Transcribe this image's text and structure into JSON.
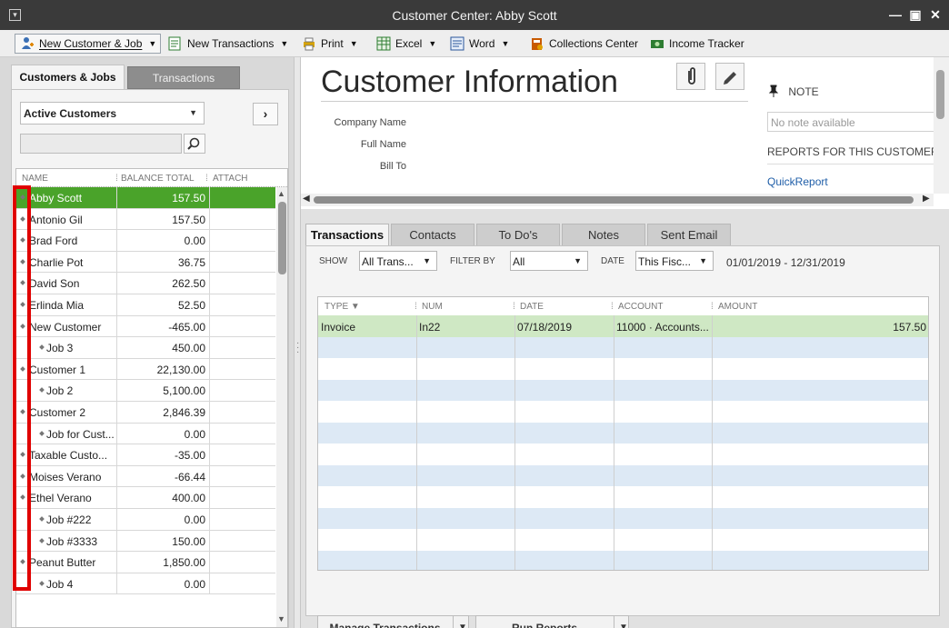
{
  "window": {
    "title": "Customer Center: Abby Scott"
  },
  "toolbar": {
    "new_customer_job": "New Customer & Job",
    "new_transactions": "New Transactions",
    "print": "Print",
    "excel": "Excel",
    "word": "Word",
    "collections_center": "Collections Center",
    "income_tracker": "Income Tracker"
  },
  "left": {
    "tab_customers_jobs": "Customers & Jobs",
    "tab_transactions": "Transactions",
    "filter_value": "Active Customers",
    "columns": {
      "name": "NAME",
      "balance": "BALANCE TOTAL",
      "attach": "ATTACH"
    },
    "rows": [
      {
        "name": "Abby Scott",
        "balance": "157.50",
        "job": false,
        "selected": true
      },
      {
        "name": "Antonio Gil",
        "balance": "157.50",
        "job": false
      },
      {
        "name": "Brad Ford",
        "balance": "0.00",
        "job": false
      },
      {
        "name": "Charlie Pot",
        "balance": "36.75",
        "job": false
      },
      {
        "name": "David Son",
        "balance": "262.50",
        "job": false
      },
      {
        "name": "Erlinda Mia",
        "balance": "52.50",
        "job": false
      },
      {
        "name": "New Customer",
        "balance": "-465.00",
        "job": false
      },
      {
        "name": "Job 3",
        "balance": "450.00",
        "job": true
      },
      {
        "name": "Customer 1",
        "balance": "22,130.00",
        "job": false
      },
      {
        "name": "Job 2",
        "balance": "5,100.00",
        "job": true
      },
      {
        "name": "Customer 2",
        "balance": "2,846.39",
        "job": false
      },
      {
        "name": "Job for Cust...",
        "balance": "0.00",
        "job": true
      },
      {
        "name": "Taxable Custo...",
        "balance": "-35.00",
        "job": false
      },
      {
        "name": "Moises Verano",
        "balance": "-66.44",
        "job": false
      },
      {
        "name": "Ethel Verano",
        "balance": "400.00",
        "job": false
      },
      {
        "name": "Job #222",
        "balance": "0.00",
        "job": true
      },
      {
        "name": "Job #3333",
        "balance": "150.00",
        "job": true
      },
      {
        "name": "Peanut Butter",
        "balance": "1,850.00",
        "job": false
      },
      {
        "name": "Job 4",
        "balance": "0.00",
        "job": true
      }
    ]
  },
  "info": {
    "title": "Customer Information",
    "company_name_label": "Company Name",
    "full_name_label": "Full Name",
    "bill_to_label": "Bill To",
    "note_label": "NOTE",
    "note_placeholder": "No note available",
    "reports_header": "REPORTS FOR THIS CUSTOMER",
    "quickreport": "QuickReport"
  },
  "tabs": [
    "Transactions",
    "Contacts",
    "To Do's",
    "Notes",
    "Sent Email"
  ],
  "filters": {
    "show_label": "SHOW",
    "show_value": "All Trans...",
    "filterby_label": "FILTER BY",
    "filterby_value": "All",
    "date_label": "DATE",
    "date_value": "This Fisc...",
    "date_range": "01/01/2019 - 12/31/2019"
  },
  "tx": {
    "columns": {
      "type": "TYPE",
      "num": "NUM",
      "date": "DATE",
      "account": "ACCOUNT",
      "amount": "AMOUNT"
    },
    "rows": [
      {
        "type": "Invoice",
        "num": "In22",
        "date": "07/18/2019",
        "account": "11000 · Accounts...",
        "amount": "157.50"
      }
    ]
  },
  "buttons": {
    "manage_transactions": "Manage Transactions",
    "run_reports": "Run Reports"
  },
  "colors": {
    "selected_row": "#4aa32a",
    "highlight": "#e00000",
    "link": "#1f5ea8"
  }
}
